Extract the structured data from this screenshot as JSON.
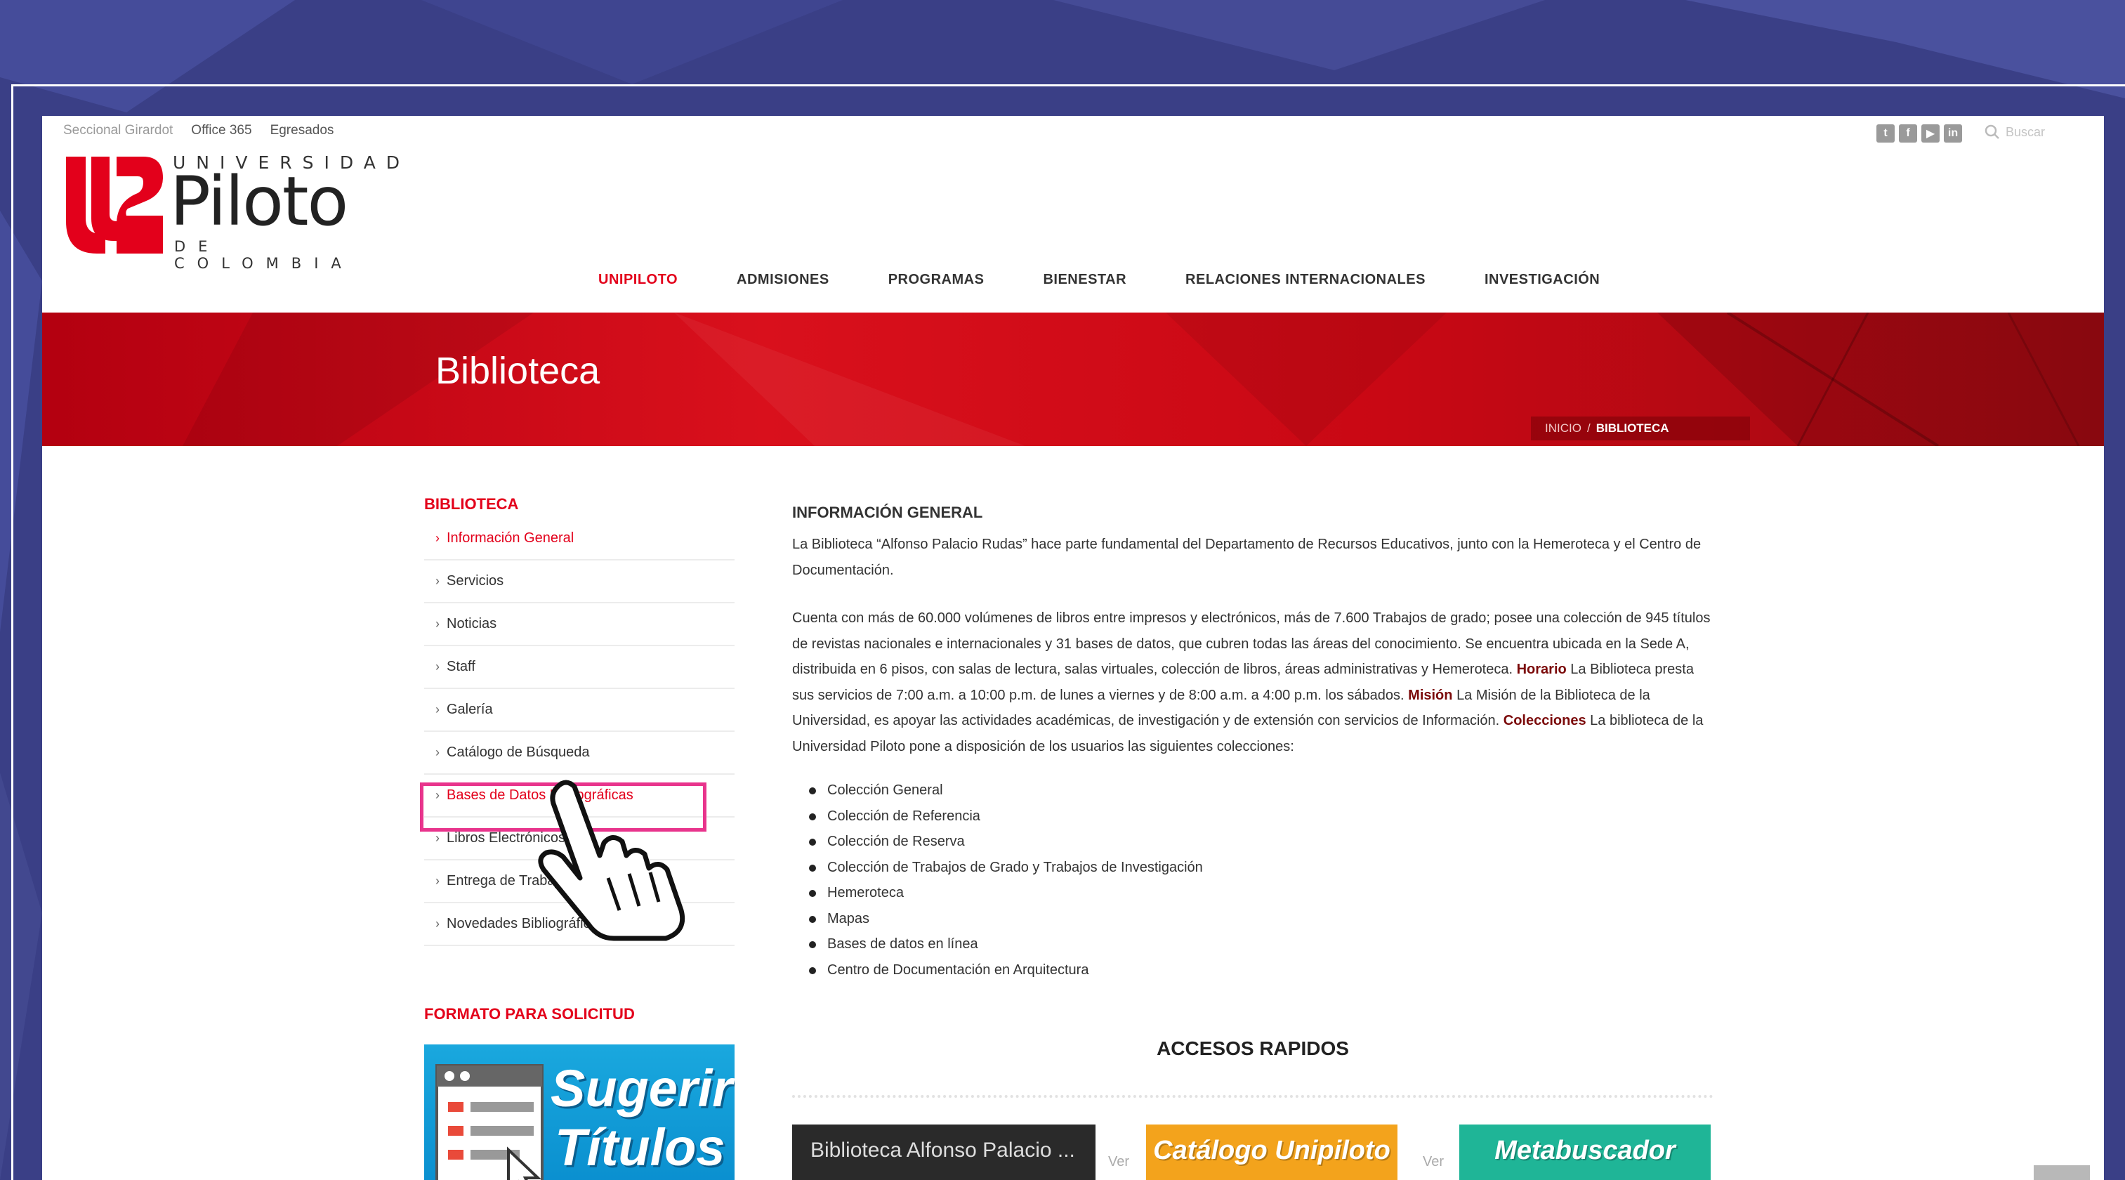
{
  "top_links": [
    "Seccional Girardot",
    "Office 365",
    "Egresados"
  ],
  "social_icons": [
    "twitter-icon",
    "facebook-icon",
    "youtube-icon",
    "linkedin-icon"
  ],
  "search": {
    "placeholder": "Buscar"
  },
  "logo": {
    "top": "UNIVERSIDAD",
    "main": "Piloto",
    "bottom": "DE COLOMBIA",
    "brand_color": "#e3001b"
  },
  "nav": [
    "UNIPILOTO",
    "ADMISIONES",
    "PROGRAMAS",
    "BIENESTAR",
    "RELACIONES INTERNACIONALES",
    "INVESTIGACIÓN"
  ],
  "banner": {
    "title": "Biblioteca",
    "crumb_home": "INICIO",
    "crumb_sep": "/",
    "crumb_current": "BIBLIOTECA"
  },
  "sidebar": {
    "heading": "BIBLIOTECA",
    "items": [
      "Información General",
      "Servicios",
      "Noticias",
      "Staff",
      "Galería",
      "Catálogo de Búsqueda",
      "Bases de Datos Bibliográficas",
      "Libros Electrónicos",
      "Entrega de Trabajos",
      "Novedades Bibliográficas"
    ],
    "form_heading": "FORMATO PARA SOLICITUD",
    "sugerir_1": "Sugerir",
    "sugerir_2": "Títulos"
  },
  "content": {
    "heading": "INFORMACIÓN GENERAL",
    "p1": "La Biblioteca “Alfonso Palacio Rudas” hace parte fundamental del Departamento de Recursos Educativos, junto con la Hemeroteca y el Centro de Documentación.",
    "p2a": "Cuenta con más de 60.000 volúmenes de libros entre impresos y electrónicos, más de 7.600 Trabajos de grado; posee una colección de 945 títulos de revistas nacionales e internacionales y 31 bases de datos, que cubren todas las áreas del conocimiento. Se encuentra ubicada en la Sede A, distribuida en 6 pisos, con salas de lectura, salas virtuales, colección de libros, áreas administrativas y Hemeroteca.",
    "horario_label": "Horario",
    "p2b": "La Biblioteca presta sus servicios de 7:00 a.m. a 10:00 p.m. de lunes a viernes y de 8:00 a.m. a 4:00 p.m. los sábados.",
    "mision_label": "Misión",
    "p2c": "La Misión de la Biblioteca de la Universidad, es apoyar las actividades académicas, de investigación y de extensión con servicios de Información.",
    "colecciones_label": "Colecciones",
    "p2d": "La biblioteca de la Universidad Piloto pone a disposición de los usuarios las siguientes colecciones:",
    "list": [
      "Colección General",
      "Colección de Referencia",
      "Colección de Reserva",
      "Colección de Trabajos de Grado y Trabajos de Investigación",
      "Hemeroteca",
      "Mapas",
      "Bases de datos en línea",
      "Centro de Documentación en Arquitectura"
    ]
  },
  "quick": {
    "title": "ACCESOS RAPIDOS",
    "video": "Biblioteca Alfonso Palacio ...",
    "ver": "Ver",
    "catalogo": "Catálogo Unipiloto",
    "meta": "Metabuscador"
  },
  "colors": {
    "accent": "#e3001b",
    "highlight": "#e8348c",
    "background": "#3a3f86"
  }
}
